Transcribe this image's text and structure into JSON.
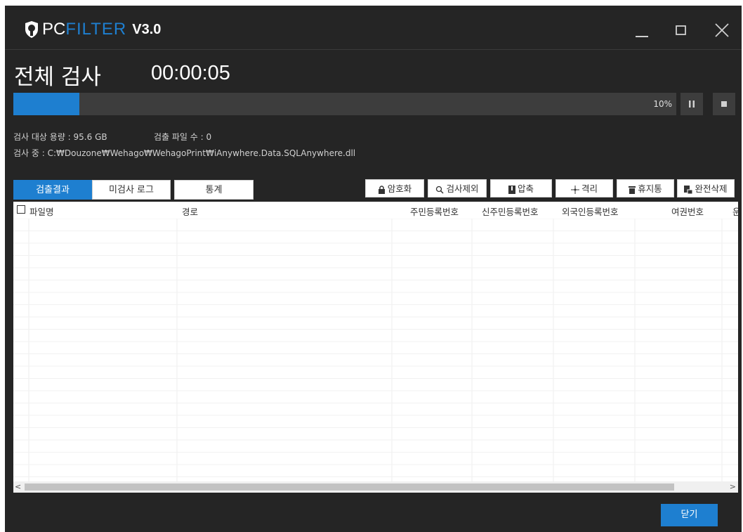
{
  "app": {
    "logo_pc": "PC",
    "logo_filter": "FILTER",
    "version": "V3.0"
  },
  "scan": {
    "title": "전체 검사",
    "elapsed": "00:00:05",
    "progress_percent": 10,
    "progress_label": "10%"
  },
  "info": {
    "target_size": "검사 대상 용량 : 95.6 GB",
    "detected_count": "검출 파일 수 : 0",
    "scanning_path": "검사 중 : C:₩Douzone₩Wehago₩WehagoPrint₩iAnywhere.Data.SQLAnywhere.dll"
  },
  "tabs": [
    {
      "label": "검출결과",
      "active": true
    },
    {
      "label": "미검사 로그",
      "active": false
    },
    {
      "label": "통계",
      "active": false
    }
  ],
  "actions": [
    {
      "label": "암호화",
      "icon": "lock-icon"
    },
    {
      "label": "검사제외",
      "icon": "magnifier-icon"
    },
    {
      "label": "압축",
      "icon": "zip-icon"
    },
    {
      "label": "격리",
      "icon": "move-icon"
    },
    {
      "label": "휴지통",
      "icon": "trash-icon"
    },
    {
      "label": "완전삭제",
      "icon": "shred-icon"
    }
  ],
  "table": {
    "columns": [
      "파일명",
      "경로",
      "주민등록번호",
      "신주민등록번호",
      "외국인등록번호",
      "여권번호",
      "운"
    ],
    "rows": []
  },
  "footer": {
    "close_label": "닫기"
  },
  "colors": {
    "accent": "#1e7fd0",
    "background": "#252525",
    "panel": "#3d3d3d"
  }
}
